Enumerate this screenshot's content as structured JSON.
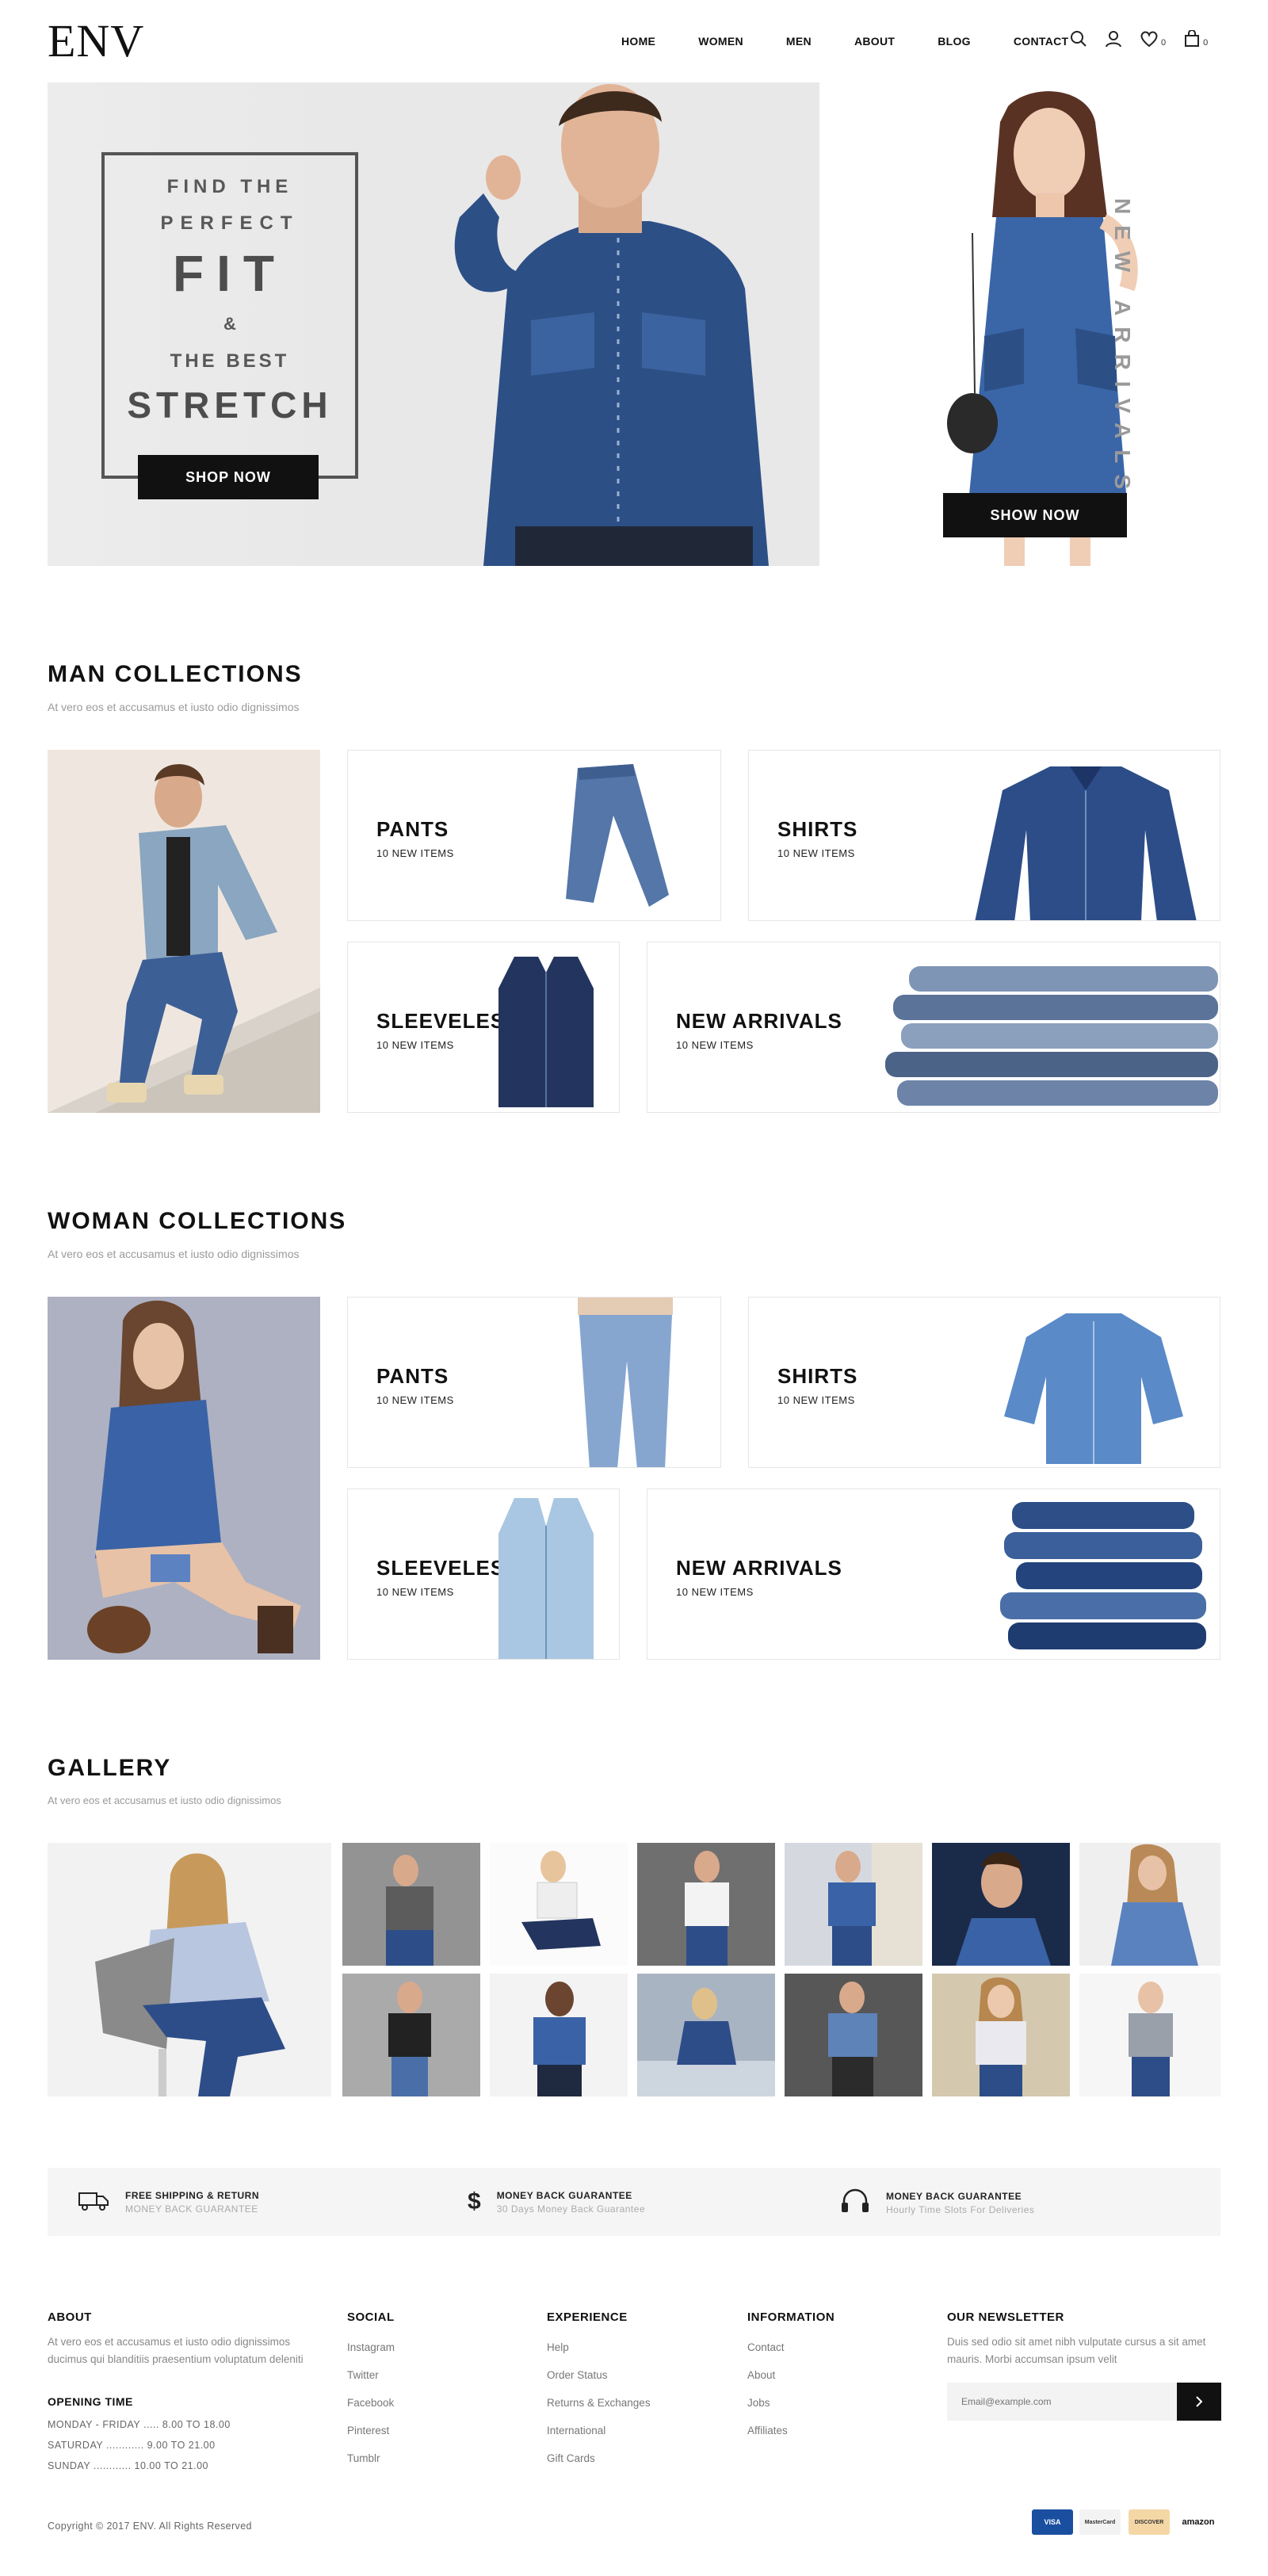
{
  "brand": {
    "logo": "ENV"
  },
  "nav": {
    "items": [
      "HOME",
      "WOMEN",
      "MEN",
      "ABOUT",
      "BLOG",
      "CONTACT"
    ]
  },
  "header_icons": {
    "wishlist_count": "0",
    "cart_count": "0"
  },
  "hero": {
    "line1": "FIND THE",
    "line2": "PERFECT",
    "line3": "FIT",
    "line4": "&",
    "line5": "THE BEST",
    "line6": "STRETCH",
    "left_button": "SHOP NOW",
    "right_vertical": "NEW ARRIVALS",
    "right_button": "SHOW NOW"
  },
  "man": {
    "title": "MAN COLLECTIONS",
    "subtitle": "At vero eos et accusamus et iusto odio dignissimos",
    "cards": [
      {
        "title": "PANTS",
        "sub": "10 NEW ITEMS"
      },
      {
        "title": "SHIRTS",
        "sub": "10 NEW ITEMS"
      },
      {
        "title": "SLEEVELESS",
        "sub": "10 NEW ITEMS"
      },
      {
        "title": "NEW ARRIVALS",
        "sub": "10 NEW ITEMS"
      }
    ]
  },
  "woman": {
    "title": "WOMAN COLLECTIONS",
    "subtitle": "At vero eos et accusamus et iusto odio dignissimos",
    "cards": [
      {
        "title": "PANTS",
        "sub": "10 NEW ITEMS"
      },
      {
        "title": "SHIRTS",
        "sub": "10 NEW ITEMS"
      },
      {
        "title": "SLEEVELESS",
        "sub": "10 NEW ITEMS"
      },
      {
        "title": "NEW ARRIVALS",
        "sub": "10 NEW ITEMS"
      }
    ]
  },
  "gallery": {
    "title": "GALLERY",
    "subtitle": "At vero eos et accusamus et iusto odio dignissimos"
  },
  "features": [
    {
      "icon": "truck-icon",
      "title": "FREE SHIPPING & RETURN",
      "sub": "MONEY BACK GUARANTEE"
    },
    {
      "icon": "dollar-icon",
      "title": "MONEY BACK GUARANTEE",
      "sub": "30 Days Money Back Guarantee"
    },
    {
      "icon": "headphones-icon",
      "title": "MONEY BACK GUARANTEE",
      "sub": "Hourly Time Slots For Deliveries"
    }
  ],
  "footer": {
    "about": {
      "title": "ABOUT",
      "text": "At vero eos et accusamus et iusto odio dignissimos ducimus qui blanditiis praesentium voluptatum deleniti",
      "opening_title": "OPENING TIME",
      "times": [
        "MONDAY - FRIDAY ..... 8.00 TO 18.00",
        "SATURDAY ............ 9.00 TO 21.00",
        "SUNDAY ............ 10.00 TO 21.00"
      ]
    },
    "social": {
      "title": "SOCIAL",
      "links": [
        "Instagram",
        "Twitter",
        "Facebook",
        "Pinterest",
        "Tumblr"
      ]
    },
    "experience": {
      "title": "EXPERIENCE",
      "links": [
        "Help",
        "Order Status",
        "Returns & Exchanges",
        "International",
        "Gift Cards"
      ]
    },
    "information": {
      "title": "INFORMATION",
      "links": [
        "Contact",
        "About",
        "Jobs",
        "Affiliates"
      ]
    },
    "newsletter": {
      "title": "OUR NEWSLETTER",
      "text": "Duis sed odio sit amet nibh vulputate cursus a sit amet mauris. Morbi accumsan ipsum velit",
      "placeholder": "Email@example.com"
    },
    "copyright": "Copyright © 2017 ENV. All Rights Reserved",
    "payments": [
      "VISA",
      "MasterCard",
      "DISCOVER",
      "amazon"
    ]
  },
  "colors": {
    "accent": "#111111",
    "denim": "#2f4f80",
    "muted": "#9a9a9a"
  }
}
